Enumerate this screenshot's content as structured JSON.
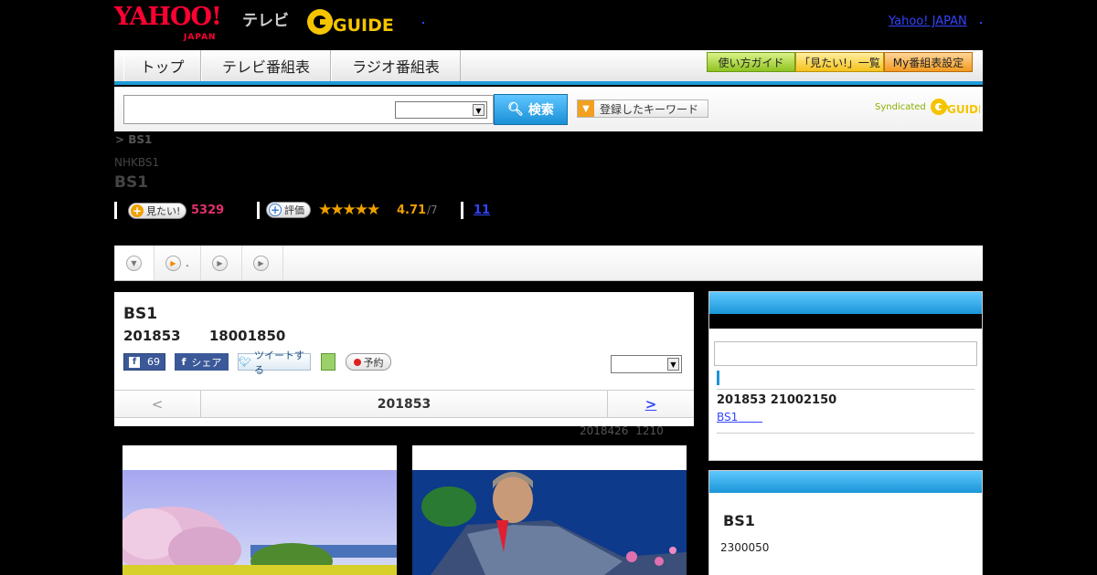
{
  "header": {
    "logo_text": "YAHOO!",
    "logo_sub": "JAPAN",
    "tv_label": "テレビ",
    "gguide_logo": "GUIDE",
    "yahoo_japan_link": "Yahoo! JAPAN"
  },
  "nav": {
    "tabs": [
      "トップ",
      "テレビ番組表",
      "ラジオ番組表"
    ],
    "buttons": [
      "使い方ガイド",
      "「見たい!」一覧",
      "My番組表設定"
    ]
  },
  "search": {
    "button_label": "検索",
    "keyword_label": "登録したキーワード",
    "syndicated": "Syndicated"
  },
  "breadcrumb": "> BS1",
  "channel": {
    "sub": "NHKBS1",
    "title": "BS1"
  },
  "stats": {
    "mitai_label": "見たい!",
    "mitai_count": "5329",
    "rate_label": "評価",
    "rating": "4.71",
    "rating_scale": "/7",
    "comments": "11",
    "stars": "★★★★★"
  },
  "tabstrip": {
    "tab2_label": "."
  },
  "program": {
    "title": "BS1",
    "date_time": "201853 18001850",
    "fb_count": "69",
    "fb_share": "シェア",
    "tweet": "ツイートする",
    "record": "予約"
  },
  "pager": {
    "prev": "<",
    "current": "201853",
    "next": ">"
  },
  "updated": "2018426 1210",
  "side1": {
    "date_time": "201853 21002150",
    "link": "BS1"
  },
  "side2": {
    "title": "BS1",
    "time": "2300050"
  },
  "colors": {
    "accent_blue": "#1a95d8",
    "brand_red": "#ff0033",
    "mitai_pink": "#e0306a",
    "rating_orange": "#f0a000"
  }
}
